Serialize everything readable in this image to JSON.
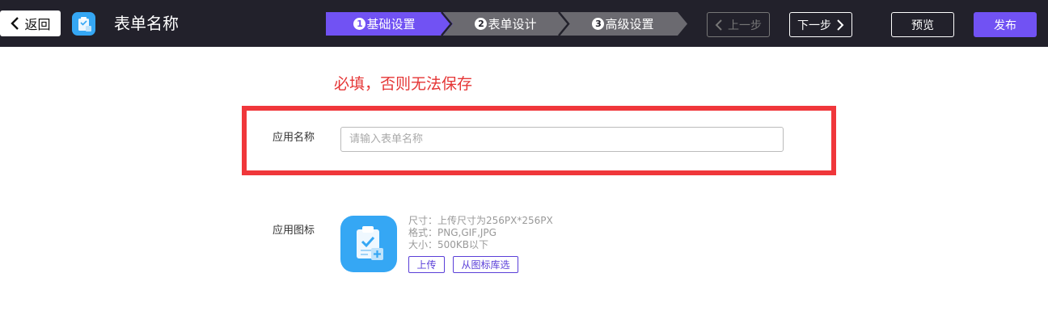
{
  "header": {
    "back_label": "返回",
    "form_title": "表单名称",
    "steps": [
      {
        "num": "1",
        "label": "基础设置",
        "state": "active",
        "color": "#7152f3"
      },
      {
        "num": "2",
        "label": "表单设计",
        "state": "inactive",
        "color": "#6b6a70"
      },
      {
        "num": "3",
        "label": "高级设置",
        "state": "inactive",
        "color": "#6b6a70"
      }
    ],
    "prev_label": "上一步",
    "next_label": "下一步",
    "preview_label": "预览",
    "publish_label": "发布",
    "accent_color": "#7152f3"
  },
  "form": {
    "required_note": "必填，否则无法保存",
    "name_label": "应用名称",
    "name_placeholder": "请输入表单名称",
    "name_value": "",
    "icon_label": "应用图标",
    "icon_info": {
      "size": "尺寸：上传尺寸为256PX*256PX",
      "format": "格式：PNG,GIF,JPG",
      "filesize": "大小：500KB以下"
    },
    "upload_label": "上传",
    "library_label": "从图标库选"
  }
}
